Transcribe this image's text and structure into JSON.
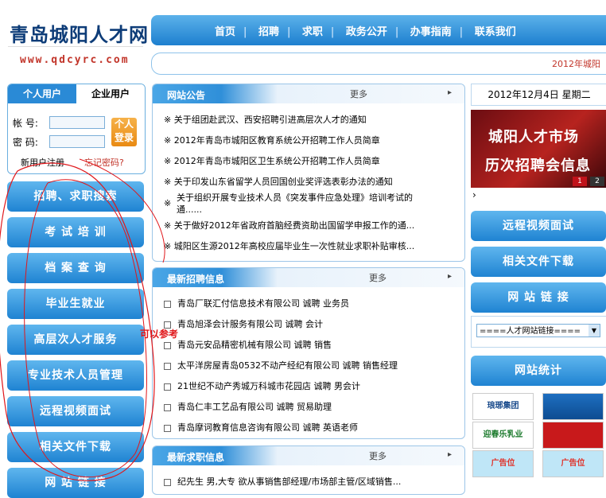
{
  "header": {
    "site_title": "青岛城阳人才网",
    "site_url": "www.qdcyrc.com",
    "nav": [
      "首页",
      "招聘",
      "求职",
      "政务公开",
      "办事指南",
      "联系我们"
    ],
    "marquee": "2012年城阳"
  },
  "login": {
    "tab_personal": "个人用户",
    "tab_enterprise": "企业用户",
    "account_label": "帐 号:",
    "password_label": "密 码:",
    "login_button_line1": "个人",
    "login_button_line2": "登录",
    "register_link": "新用户注册",
    "forgot_link": "忘记密码?"
  },
  "left_menu": [
    "招聘、求职搜索",
    "考 试 培 训",
    "档 案 查 询",
    "毕业生就业",
    "高层次人才服务",
    "专业技术人员管理",
    "远程视频面试",
    "相关文件下载",
    "网 站 链 接"
  ],
  "annotation": "可以参考",
  "notices": {
    "title": "网站公告",
    "more": "更多",
    "items": [
      "※ 关于组团赴武汉、西安招聘引进高层次人才的通知",
      "※ 2012年青岛市城阳区教育系统公开招聘工作人员简章",
      "※ 2012年青岛市城阳区卫生系统公开招聘工作人员简章",
      "※ 关于印发山东省留学人员回国创业奖评选表彰办法的通知",
      "关于组织开展专业技术人员《突发事件应急处理》培训考试的",
      "通......",
      "※ 关于做好2012年省政府首脑经费资助出国留学申报工作的通...",
      "※ 城阳区生源2012年高校应届毕业生一次性就业求职补贴审核..."
    ]
  },
  "jobs": {
    "title": "最新招聘信息",
    "more": "更多",
    "items": [
      "青岛厂联汇付信息技术有限公司  诚聘  业务员",
      "青岛旭泽会计服务有限公司  诚聘  会计",
      "青岛元安品精密机械有限公司  诚聘  销售",
      "太平洋房屋青岛0532不动产经纪有限公司  诚聘  销售经理",
      "21世纪不动产秀城万科城市花园店  诚聘  男会计",
      "青岛仁丰工艺品有限公司  诚聘  贸易助理",
      "青岛摩诃教育信息咨询有限公司  诚聘  英语老师"
    ]
  },
  "seekers": {
    "title": "最新求职信息",
    "more": "更多",
    "items": [
      "纪先生  男,大专  欲从事销售部经理/市场部主管/区域销售..."
    ]
  },
  "right": {
    "date": "2012年12月4日  星期二",
    "banner_line1": "城阳人才市场",
    "banner_line2": "历次招聘会信息",
    "banner_pages": [
      "1",
      "2"
    ],
    "buttons": [
      "远程视频面试",
      "相关文件下载",
      "网 站 链 接"
    ],
    "link_select": "====人才网站链接====",
    "stats_button": "网站统计",
    "logos": [
      "琅琊集团",
      "",
      "迎春乐乳业",
      "",
      "广告位",
      "广告位"
    ]
  }
}
